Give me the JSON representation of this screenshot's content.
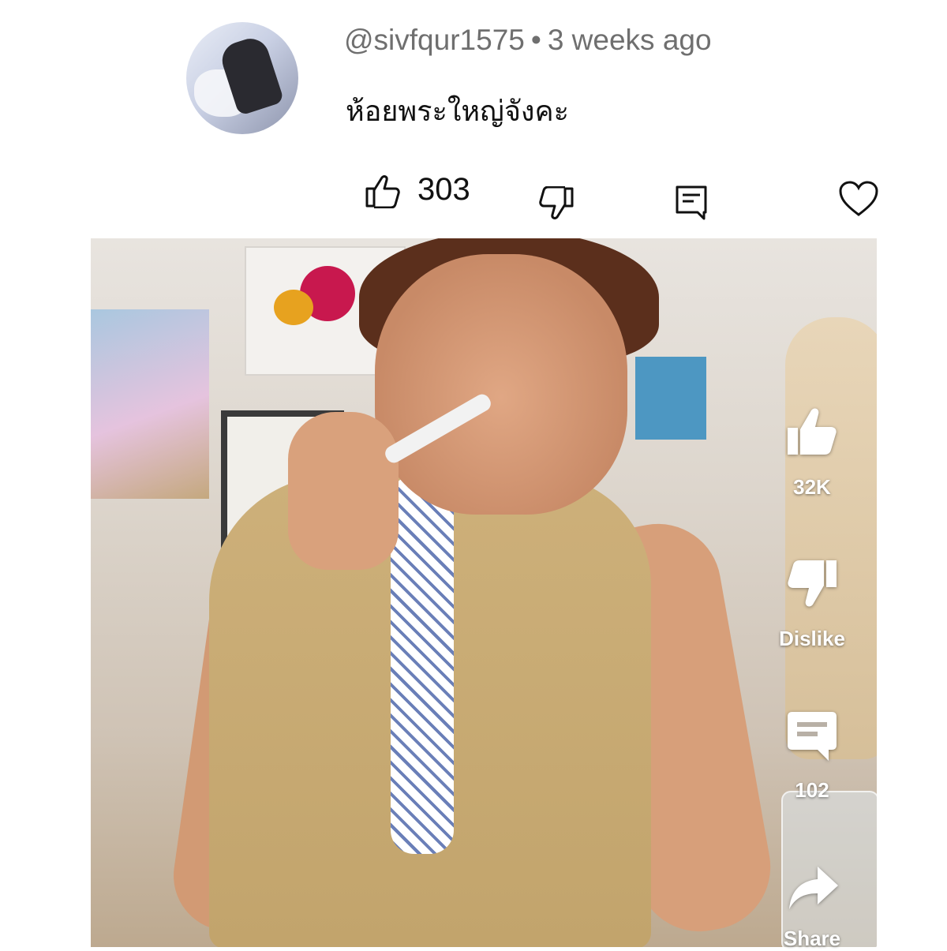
{
  "comment": {
    "username": "@sivfqur1575",
    "separator": "•",
    "time_ago": "3 weeks ago",
    "text": "ห้อยพระใหญ่จังคะ",
    "like_count": "303"
  },
  "short": {
    "like_count": "32K",
    "dislike_label": "Dislike",
    "comment_count": "102",
    "share_label": "Share"
  },
  "icons": {
    "like": "thumbs-up-icon",
    "dislike": "thumbs-down-icon",
    "reply": "reply-icon",
    "heart": "heart-icon",
    "share": "share-icon"
  }
}
